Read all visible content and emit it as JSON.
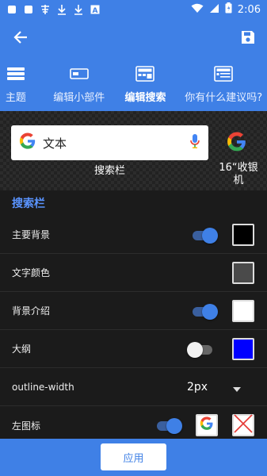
{
  "status_bar": {
    "time": "2:06",
    "notification_icons": [
      "square-icon",
      "square-icon",
      "app-icon",
      "download-icon",
      "download-icon",
      "font-icon"
    ],
    "system_icons": [
      "wifi-icon",
      "signal-icon",
      "battery-icon"
    ]
  },
  "header": {
    "back_icon": "arrow-left-icon",
    "save_icon": "floppy-disk-icon"
  },
  "tabs": [
    {
      "label": "主题",
      "icon": "layers-icon",
      "active": false
    },
    {
      "label": "编辑小部件",
      "icon": "widget-icon",
      "active": false
    },
    {
      "label": "编辑搜索",
      "icon": "search-layout-icon",
      "active": true
    },
    {
      "label": "你有什么建议吗?",
      "icon": "feedback-icon",
      "active": false
    }
  ],
  "preview": {
    "search_text": "文本",
    "widget_caption": "搜索栏",
    "standalone_caption": "16“收银机"
  },
  "settings": {
    "section_title": "搜索栏",
    "rows": [
      {
        "label": "主要背景",
        "switch": "on",
        "color": "#000000"
      },
      {
        "label": "文字颜色",
        "color": "#4a4a4a"
      },
      {
        "label": "背景介绍",
        "switch": "on",
        "color": "#ffffff"
      },
      {
        "label": "大纲",
        "switch": "off",
        "color": "#0000ff"
      },
      {
        "label": "outline-width",
        "value": "2px"
      },
      {
        "label": "左图标",
        "switch": "on"
      }
    ]
  },
  "footer": {
    "apply_label": "应用"
  },
  "colors": {
    "accent": "#3f80e6",
    "background": "#1b1b1b",
    "section_title": "#5a94ff"
  }
}
